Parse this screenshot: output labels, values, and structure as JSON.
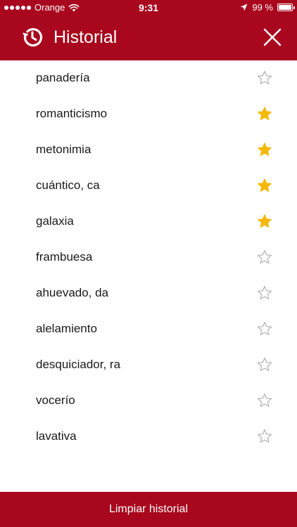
{
  "status_bar": {
    "carrier": "Orange",
    "time": "9:31",
    "battery_text": "99 %",
    "battery_level": 0.99
  },
  "nav": {
    "title": "Historial"
  },
  "colors": {
    "accent": "#a8071d",
    "star_filled": "#f5b800",
    "star_empty": "#b0b0b0"
  },
  "icons": {
    "history": "history-icon",
    "close": "close-icon",
    "favorite": "star-icon"
  },
  "history": [
    {
      "word": "panadería",
      "favorite": false
    },
    {
      "word": "romanticismo",
      "favorite": true
    },
    {
      "word": "metonimia",
      "favorite": true
    },
    {
      "word": "cuántico, ca",
      "favorite": true
    },
    {
      "word": "galaxia",
      "favorite": true
    },
    {
      "word": "frambuesa",
      "favorite": false
    },
    {
      "word": "ahuevado, da",
      "favorite": false
    },
    {
      "word": "alelamiento",
      "favorite": false
    },
    {
      "word": "desquiciador, ra",
      "favorite": false
    },
    {
      "word": "vocerío",
      "favorite": false
    },
    {
      "word": "lavativa",
      "favorite": false
    }
  ],
  "footer": {
    "clear_label": "Limpiar historial"
  }
}
